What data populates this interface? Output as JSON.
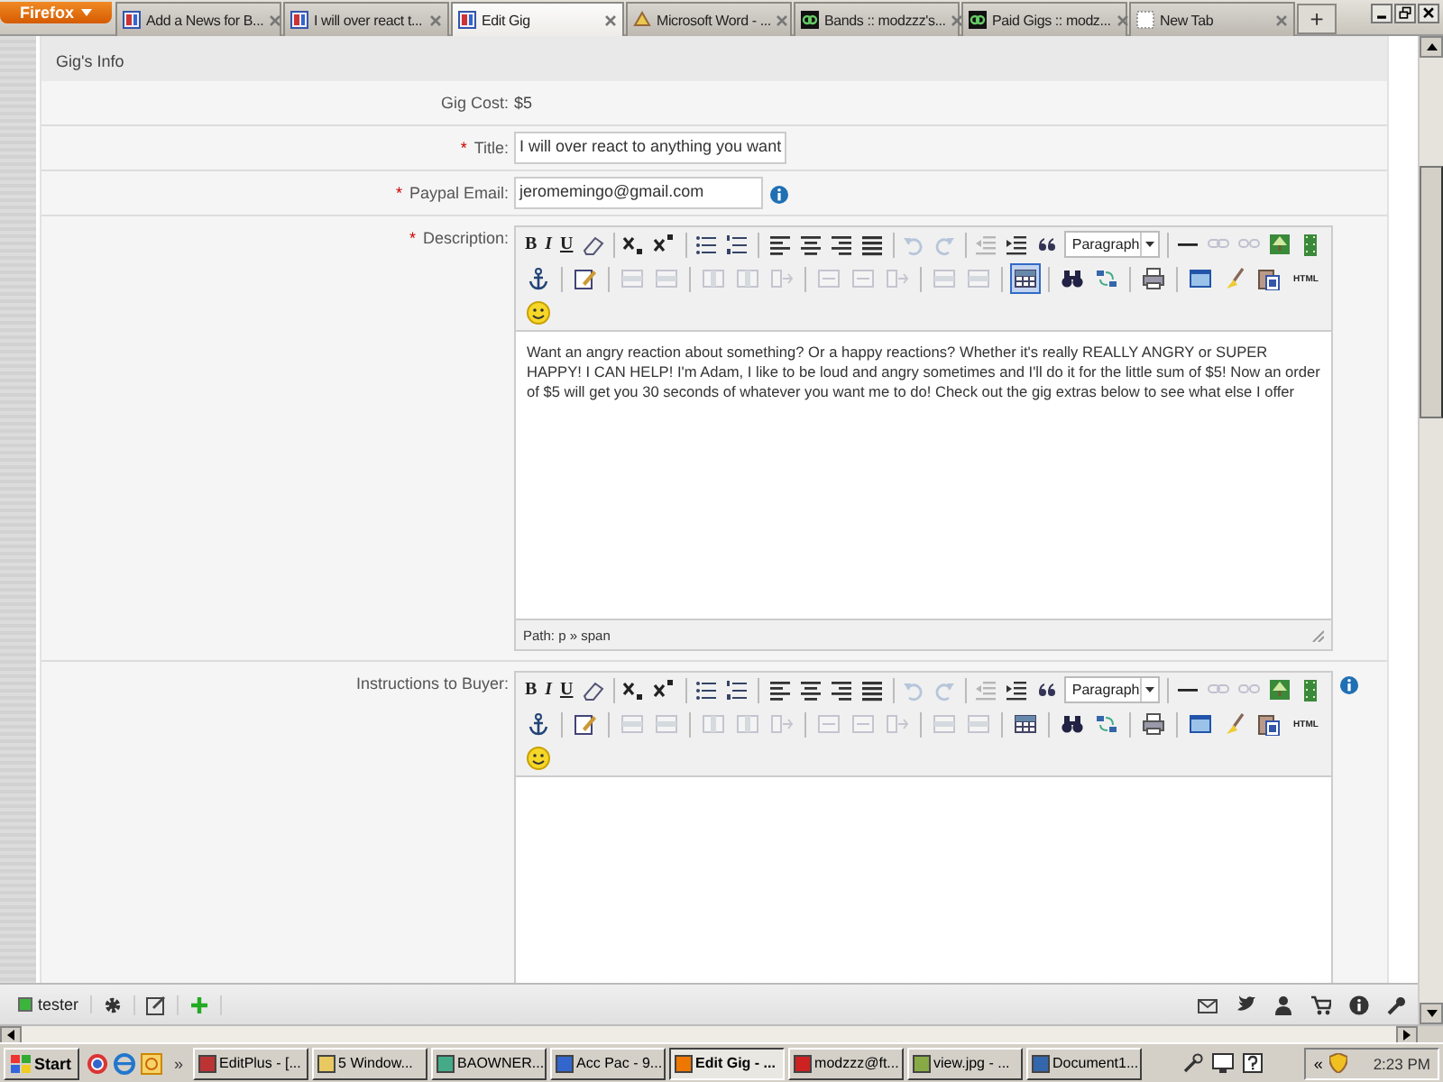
{
  "browser": {
    "menu_button": "Firefox",
    "tabs": [
      {
        "label": "Add a News for B...",
        "kind": "site",
        "selected": false
      },
      {
        "label": "I will over react t...",
        "kind": "site",
        "selected": false
      },
      {
        "label": "Edit Gig",
        "kind": "site",
        "selected": true
      },
      {
        "label": "Microsoft Word - ...",
        "kind": "word",
        "selected": false
      },
      {
        "label": "Bands :: modzzz's...",
        "kind": "logo",
        "selected": false
      },
      {
        "label": "Paid Gigs :: modz...",
        "kind": "logo",
        "selected": false
      },
      {
        "label": "New Tab",
        "kind": "blank",
        "selected": false
      }
    ],
    "new_tab": "+"
  },
  "form": {
    "section_title": "Gig's Info",
    "fields": [
      {
        "kind": "text",
        "label": "Gig Cost:",
        "value": "$5"
      },
      {
        "kind": "input",
        "label": "Title:",
        "marker": "*",
        "value": "I will over react to anything you want"
      },
      {
        "kind": "input",
        "label": "Paypal Email:",
        "marker": "*",
        "value": "jeromemingo@gmail.com",
        "info": true
      },
      {
        "kind": "editor",
        "label": "Description:",
        "marker": "*",
        "format": "Paragraph",
        "content": "Want an angry reaction about something? Or a happy reactions? Whether it's really REALLY ANGRY or SUPER HAPPY! I CAN HELP! I'm Adam, I like to be loud and angry sometimes and I'll do it for the little sum of $5! Now an order of $5 will get you 30 seconds of whatever you want me to do! Check out the gig extras below to see what else I offer",
        "path": "Path: p » span",
        "table_selected": true,
        "toolbar": [
          [
            {
              "kind": "bold",
              "label": "B",
              "disabled": false
            },
            {
              "kind": "italic",
              "label": "I",
              "disabled": false
            },
            {
              "kind": "underline",
              "label": "U",
              "disabled": false
            },
            {
              "kind": "eraser",
              "disabled": false
            },
            {
              "kind": "separator"
            },
            {
              "kind": "subscript",
              "disabled": false
            },
            {
              "kind": "superscript",
              "disabled": false
            },
            {
              "kind": "separator"
            },
            {
              "kind": "bullet-list",
              "disabled": false
            },
            {
              "kind": "numbered-list",
              "disabled": false
            },
            {
              "kind": "separator"
            },
            {
              "kind": "align-left",
              "disabled": false
            },
            {
              "kind": "align-center",
              "disabled": false
            },
            {
              "kind": "align-right",
              "disabled": false
            },
            {
              "kind": "align-justify",
              "disabled": false
            },
            {
              "kind": "separator"
            },
            {
              "kind": "undo",
              "disabled": true
            },
            {
              "kind": "redo",
              "disabled": true
            },
            {
              "kind": "separator"
            },
            {
              "kind": "outdent",
              "disabled": true
            },
            {
              "kind": "indent",
              "disabled": false
            },
            {
              "kind": "blockquote",
              "disabled": false
            },
            {
              "kind": "format"
            },
            {
              "kind": "separator"
            },
            {
              "kind": "horizontal-rule",
              "disabled": false
            },
            {
              "kind": "link",
              "disabled": true
            },
            {
              "kind": "unlink",
              "disabled": true
            },
            {
              "kind": "image",
              "disabled": false
            },
            {
              "kind": "media",
              "disabled": false
            }
          ],
          [
            {
              "kind": "anchor",
              "disabled": false
            },
            {
              "kind": "separator"
            },
            {
              "kind": "edit",
              "disabled": false
            },
            {
              "kind": "separator"
            },
            {
              "kind": "table-row",
              "disabled": true
            },
            {
              "kind": "table-row",
              "disabled": true
            },
            {
              "kind": "separator"
            },
            {
              "kind": "table-column",
              "disabled": true
            },
            {
              "kind": "table-column",
              "disabled": true
            },
            {
              "kind": "table-split",
              "disabled": true
            },
            {
              "kind": "separator"
            },
            {
              "kind": "table-merge",
              "disabled": true
            },
            {
              "kind": "table-merge",
              "disabled": true
            },
            {
              "kind": "table-split",
              "disabled": true
            },
            {
              "kind": "separator"
            },
            {
              "kind": "table-row",
              "disabled": true
            },
            {
              "kind": "table-row",
              "disabled": true
            },
            {
              "kind": "separator"
            },
            {
              "kind": "table",
              "disabled": false
            },
            {
              "kind": "separator"
            },
            {
              "kind": "search",
              "disabled": false
            },
            {
              "kind": "replace",
              "disabled": false
            },
            {
              "kind": "separator"
            },
            {
              "kind": "print",
              "disabled": false
            },
            {
              "kind": "separator"
            },
            {
              "kind": "fullscreen",
              "disabled": false
            },
            {
              "kind": "cleanup",
              "disabled": false
            },
            {
              "kind": "paste-word",
              "disabled": false
            },
            {
              "kind": "html",
              "label": "HTML",
              "disabled": false
            }
          ],
          [
            {
              "kind": "emoticon",
              "disabled": false
            }
          ]
        ]
      },
      {
        "kind": "editor",
        "label": "Instructions to Buyer:",
        "info": true,
        "format": "Paragraph",
        "table_selected": false,
        "toolbar": [
          [
            {
              "kind": "bold",
              "label": "B",
              "disabled": false
            },
            {
              "kind": "italic",
              "label": "I",
              "disabled": false
            },
            {
              "kind": "underline",
              "label": "U",
              "disabled": false
            },
            {
              "kind": "eraser",
              "disabled": false
            },
            {
              "kind": "separator"
            },
            {
              "kind": "subscript",
              "disabled": false
            },
            {
              "kind": "superscript",
              "disabled": false
            },
            {
              "kind": "separator"
            },
            {
              "kind": "bullet-list",
              "disabled": false
            },
            {
              "kind": "numbered-list",
              "disabled": false
            },
            {
              "kind": "separator"
            },
            {
              "kind": "align-left",
              "disabled": false
            },
            {
              "kind": "align-center",
              "disabled": false
            },
            {
              "kind": "align-right",
              "disabled": false
            },
            {
              "kind": "align-justify",
              "disabled": false
            },
            {
              "kind": "separator"
            },
            {
              "kind": "undo",
              "disabled": true
            },
            {
              "kind": "redo",
              "disabled": true
            },
            {
              "kind": "separator"
            },
            {
              "kind": "outdent",
              "disabled": true
            },
            {
              "kind": "indent",
              "disabled": false
            },
            {
              "kind": "blockquote",
              "disabled": false
            },
            {
              "kind": "format"
            },
            {
              "kind": "separator"
            },
            {
              "kind": "horizontal-rule",
              "disabled": false
            },
            {
              "kind": "link",
              "disabled": true
            },
            {
              "kind": "unlink",
              "disabled": true
            },
            {
              "kind": "image",
              "disabled": false
            },
            {
              "kind": "media",
              "disabled": false
            }
          ],
          [
            {
              "kind": "anchor",
              "disabled": false
            },
            {
              "kind": "separator"
            },
            {
              "kind": "edit",
              "disabled": false
            },
            {
              "kind": "separator"
            },
            {
              "kind": "table-row",
              "disabled": true
            },
            {
              "kind": "table-row",
              "disabled": true
            },
            {
              "kind": "separator"
            },
            {
              "kind": "table-column",
              "disabled": true
            },
            {
              "kind": "table-column",
              "disabled": true
            },
            {
              "kind": "table-split",
              "disabled": true
            },
            {
              "kind": "separator"
            },
            {
              "kind": "table-merge",
              "disabled": true
            },
            {
              "kind": "table-merge",
              "disabled": true
            },
            {
              "kind": "table-split",
              "disabled": true
            },
            {
              "kind": "separator"
            },
            {
              "kind": "table-row",
              "disabled": true
            },
            {
              "kind": "table-row",
              "disabled": true
            },
            {
              "kind": "separator"
            },
            {
              "kind": "table",
              "disabled": false
            },
            {
              "kind": "separator"
            },
            {
              "kind": "search",
              "disabled": false
            },
            {
              "kind": "replace",
              "disabled": false
            },
            {
              "kind": "separator"
            },
            {
              "kind": "print",
              "disabled": false
            },
            {
              "kind": "separator"
            },
            {
              "kind": "fullscreen",
              "disabled": false
            },
            {
              "kind": "cleanup",
              "disabled": false
            },
            {
              "kind": "paste-word",
              "disabled": false
            },
            {
              "kind": "html",
              "label": "HTML",
              "disabled": false
            }
          ],
          [
            {
              "kind": "emoticon",
              "disabled": false
            }
          ]
        ]
      }
    ]
  },
  "addon_bar": {
    "user": "tester",
    "online": true
  },
  "taskbar": {
    "start": "Start",
    "more": "»",
    "items": [
      {
        "label": "EditPlus - [...",
        "selected": false
      },
      {
        "label": "5 Window...",
        "selected": false
      },
      {
        "label": "BAOWNER...",
        "selected": false
      },
      {
        "label": "Acc Pac - 9...",
        "selected": false
      },
      {
        "label": "Edit Gig - ...",
        "selected": true
      },
      {
        "label": "modzzz@ft...",
        "selected": false
      },
      {
        "label": "view.jpg - ...",
        "selected": false
      },
      {
        "label": "Document1...",
        "selected": false
      }
    ],
    "tray_toggle": "«",
    "clock": "2:23 PM"
  }
}
